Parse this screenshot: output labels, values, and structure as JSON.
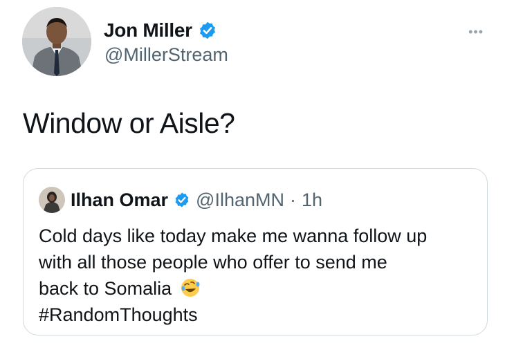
{
  "author": {
    "name": "Jon Miller",
    "handle": "@MillerStream",
    "verified": true
  },
  "menu_icon": "more-horizontal-icon",
  "tweet_text": "Window or Aisle?",
  "quoted": {
    "name": "Ilhan Omar",
    "handle": "@IlhanMN",
    "separator": "·",
    "time": "1h",
    "verified": true,
    "lines": [
      "Cold days like today make me wanna follow up",
      "with all those people who offer to send me",
      "back to Somalia"
    ],
    "emoji": "rolling-on-floor-laughing-emoji",
    "hashtag": "#RandomThoughts"
  },
  "colors": {
    "verified": "#1d9bf0",
    "secondary_text": "#536471",
    "border": "#cfd9de"
  }
}
